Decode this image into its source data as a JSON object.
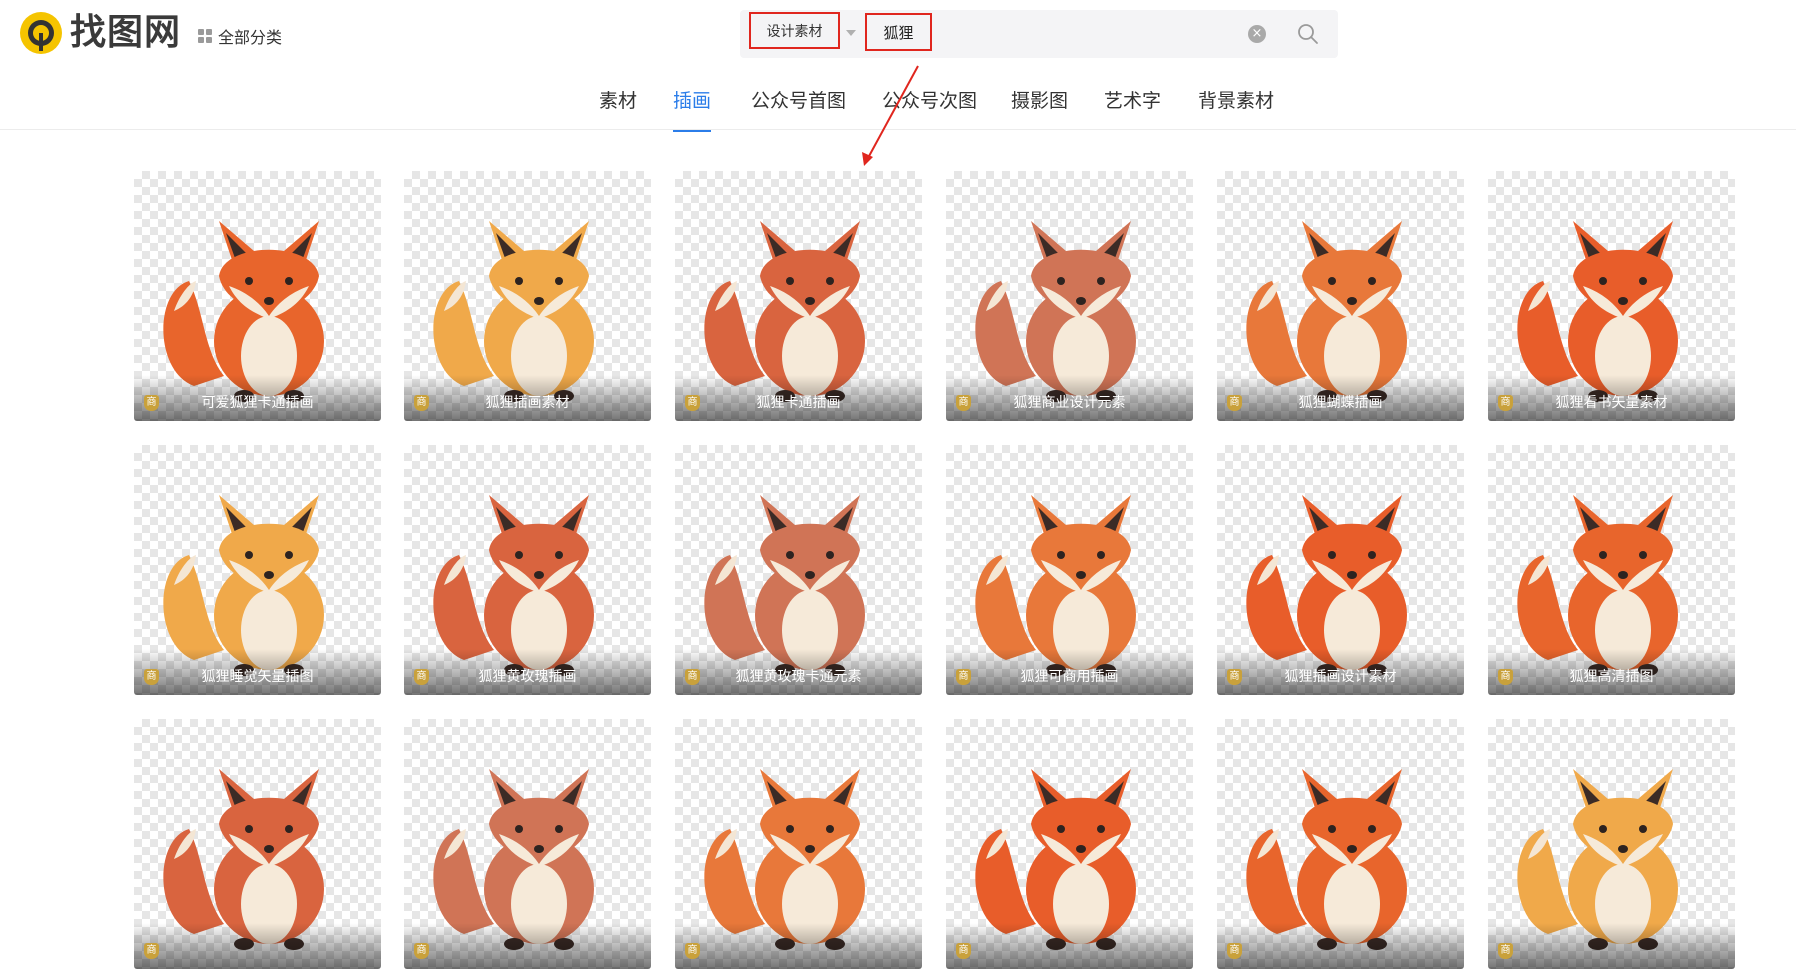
{
  "header": {
    "logo_text": "找图网",
    "all_categories_label": "全部分类"
  },
  "search": {
    "scope_label": "设计素材",
    "query": "狐狸"
  },
  "tabs": [
    {
      "label": "素材",
      "active": false
    },
    {
      "label": "插画",
      "active": true
    },
    {
      "label": "公众号首图",
      "active": false
    },
    {
      "label": "公众号次图",
      "active": false
    },
    {
      "label": "摄影图",
      "active": false
    },
    {
      "label": "艺术字",
      "active": false
    },
    {
      "label": "背景素材",
      "active": false
    }
  ],
  "commercial_badge": "商",
  "results": [
    {
      "title": "可爱狐狸卡通插画"
    },
    {
      "title": "狐狸插画素材"
    },
    {
      "title": "狐狸卡通插画"
    },
    {
      "title": "狐狸商业设计元素"
    },
    {
      "title": "狐狸蝴蝶插画"
    },
    {
      "title": "狐狸看书矢量素材"
    },
    {
      "title": "狐狸睡觉矢量插图"
    },
    {
      "title": "狐狸黄玫瑰插画"
    },
    {
      "title": "狐狸黄玫瑰卡通元素"
    },
    {
      "title": "狐狸可商用插画"
    },
    {
      "title": "狐狸插画设计素材"
    },
    {
      "title": "狐狸高清插图"
    },
    {
      "title": ""
    },
    {
      "title": ""
    },
    {
      "title": ""
    },
    {
      "title": ""
    },
    {
      "title": ""
    },
    {
      "title": ""
    }
  ],
  "colors": {
    "accent_blue": "#2b7de9",
    "highlight_red": "#e0261e",
    "badge_gold": "#c9a13b",
    "fox_orange": "#e8652c"
  }
}
